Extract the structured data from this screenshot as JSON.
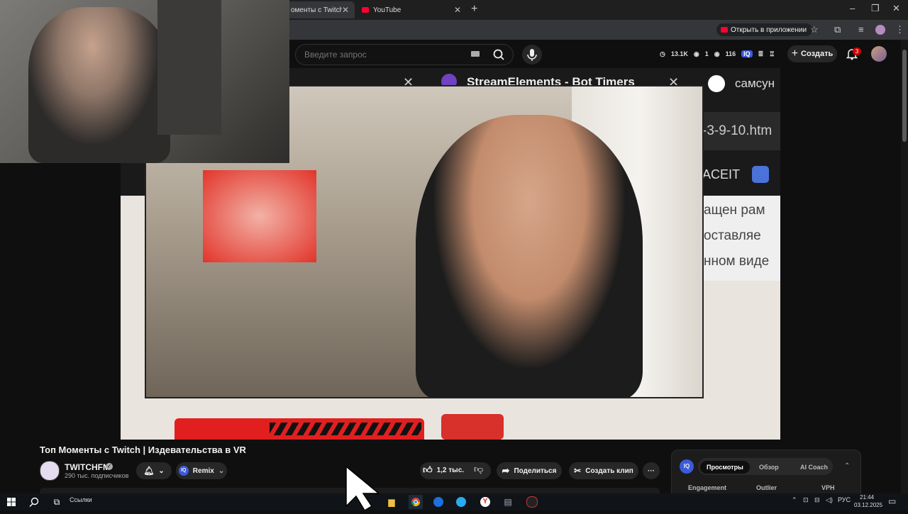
{
  "browser": {
    "tabs": [
      {
        "label": "оменты с Twitch | Изд"
      },
      {
        "label": "YouTube"
      }
    ],
    "new_tab": "+",
    "window": {
      "minimize": "–",
      "restore": "❐",
      "close": "✕"
    },
    "open_in_app": "Открыть в приложении"
  },
  "youtube": {
    "search_placeholder": "Введите запрос",
    "stats": {
      "views": "13.1K",
      "likes": "1",
      "watchers": "116"
    },
    "create_label": "Создать",
    "notifications": "3"
  },
  "video_content": {
    "overlay_top": "StreamElements - Bot Timers",
    "google_text": "самсун",
    "url_text": "-3-9-10.htm",
    "faceit": "ACEIT",
    "ru_line1": "ащен рам",
    "ru_line2": "оставляе",
    "ru_line3": "нном виде"
  },
  "video": {
    "title": "Топ Моменты с Twitch | Издевательства в VR",
    "channel_name": "TWITCHFM",
    "subscribers": "290 тыс. подписчиков",
    "remix_label": "Remix",
    "likes": "1,2 тыс.",
    "share_label": "Поделиться",
    "clip_label": "Создать клип",
    "more": "···"
  },
  "side_panel": {
    "tabs": [
      "Просмотры",
      "Обзор",
      "AI Coach"
    ],
    "columns": [
      "Engagement",
      "Outlier",
      "VPH"
    ]
  },
  "taskbar": {
    "links_label": "Ссылки",
    "lang": "РУС",
    "time": "21:44",
    "date": "03.12.2025"
  },
  "colors": {
    "accent": "#ff0033",
    "badge": "#cc0000",
    "iq": "#3b5bdb"
  }
}
